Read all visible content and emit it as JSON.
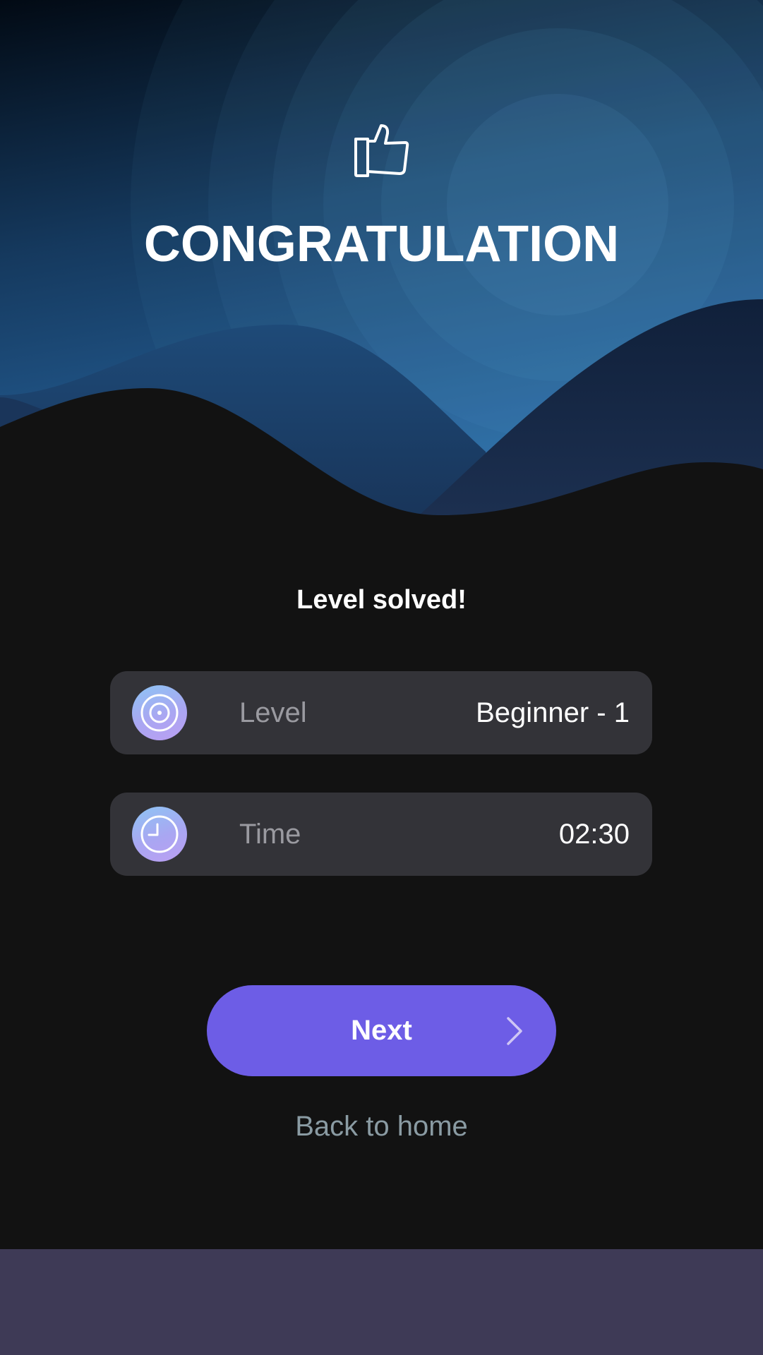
{
  "header": {
    "title": "CONGRATULATION",
    "icon": "thumbs-up-icon"
  },
  "result": {
    "subtitle": "Level solved!"
  },
  "stats": {
    "level": {
      "label": "Level",
      "value": "Beginner - 1",
      "icon": "target-icon"
    },
    "time": {
      "label": "Time",
      "value": "02:30",
      "icon": "clock-icon"
    }
  },
  "actions": {
    "next_label": "Next",
    "next_icon": "chevron-right-icon",
    "back_home_label": "Back to home"
  },
  "colors": {
    "background": "#121212",
    "card": "#333338",
    "accent": "#6d5de6",
    "link": "#8a9ba3",
    "bottom_bar": "#3e3a56"
  }
}
